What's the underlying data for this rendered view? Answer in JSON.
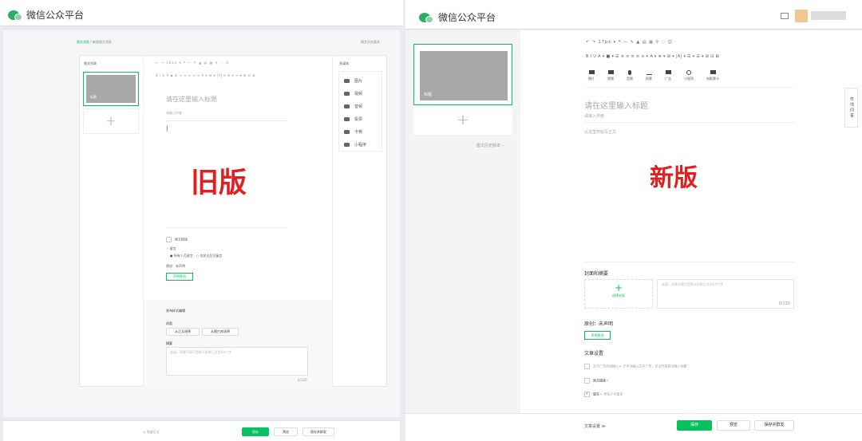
{
  "app_title": "微信公众平台",
  "old": {
    "breadcrumb_home": "图文消息",
    "breadcrumb_sep": "/",
    "breadcrumb_current": "新建图文消息",
    "history_link": "图文历史版本",
    "list_title": "图文列表",
    "cover_label": "标题",
    "add": "+",
    "toolbar_row1": "←  →  16px  ▾   ❝  —  ✎  ▲  ▤  ▦  ⚲  ◌  ☺",
    "toolbar_row2": "B  I  U  A  ▪  ☰  ≡  ≡  ≡  ≡  ≡  A  ▾  ⊞  ▾  |A|  ▾  ☰  ▾  ≡  ▾  ⊞  ⊟  ⊠",
    "title_placeholder": "请在这里输入标题",
    "author_placeholder": "请输入作者",
    "cursor": "|",
    "version_label": "旧版",
    "original_link": "原文链接",
    "comment": "留言",
    "comment_opt_all": "所有人可留言",
    "comment_opt_follow": "仅关注后可留言",
    "original_status": "原创：未声明",
    "original_btn": "声明原创",
    "publish_section": "发布样式编辑",
    "cover_heading": "封面",
    "from_article": "从正文选择",
    "from_library": "从图片库选择",
    "summary_heading": "摘要",
    "summary_placeholder": "选填，如果不填写会默认抓取正文前54个字",
    "counter": "0/120",
    "media_title": "多媒体",
    "media": [
      {
        "icon": "image-icon",
        "label": "图片"
      },
      {
        "icon": "video-icon",
        "label": "视频"
      },
      {
        "icon": "audio-icon",
        "label": "音频"
      },
      {
        "icon": "poll-icon",
        "label": "投票"
      },
      {
        "icon": "card-icon",
        "label": "卡券"
      },
      {
        "icon": "miniprogram-icon",
        "label": "小程序"
      }
    ],
    "autosave": "◎ 保留正文",
    "save": "保存",
    "preview": "预览",
    "save_send": "保存并群发"
  },
  "new": {
    "toolbar_row1": "↶  ↷   17px  ▾   ❝  —  ✎  ▲  ▤  ▦   ⚲  ◌  ☺",
    "toolbar_row2": "B  I  U  A ▾ ■ ▾  ☰  ≡  ≡  ≡  ≡  ≡ ▾  A ▾  ≣ ▾  ⊞ ▾  |A| ▾  ☰ ▾  ☰ ▾  ⊞  ⊟  ⊠",
    "media": [
      {
        "icon": "image-icon",
        "label": "图片"
      },
      {
        "icon": "video-icon",
        "label": "视频"
      },
      {
        "icon": "audio-icon",
        "label": "音频"
      },
      {
        "icon": "poll-icon",
        "label": "投票"
      },
      {
        "icon": "ad-icon",
        "label": "广告"
      },
      {
        "icon": "miniprogram-icon",
        "label": "小程序"
      },
      {
        "icon": "movie-icon",
        "label": "电影票卡"
      }
    ],
    "cover_label": "标题",
    "add": "+",
    "history": "图文历史版本  ›",
    "title_placeholder": "请在这里输入标题",
    "author_placeholder": "请输入作者",
    "body_placeholder": "从这里开始写正文",
    "version_label": "新版",
    "cover_summary_heading": "封面和摘要",
    "select_cover_plus": "+",
    "select_cover": "选择封面",
    "summary_placeholder": "选填，如果不填写会默认抓取正文前54个字",
    "counter": "0/120",
    "original_status": "原创：未声明",
    "original_btn": "声明原创",
    "article_settings": "文章设置",
    "ad_insert": "文中广告自动插入",
    "ad_note": "已手动插入文中广告，无法开启自动插入功能",
    "original_link": "原文链接",
    "comment": "留言",
    "comment_note": "所有人可留言",
    "settings_link": "文章设置 ≫",
    "save": "保存",
    "preview": "预览",
    "save_send": "保存并群发",
    "online_qa": "在线问答"
  }
}
